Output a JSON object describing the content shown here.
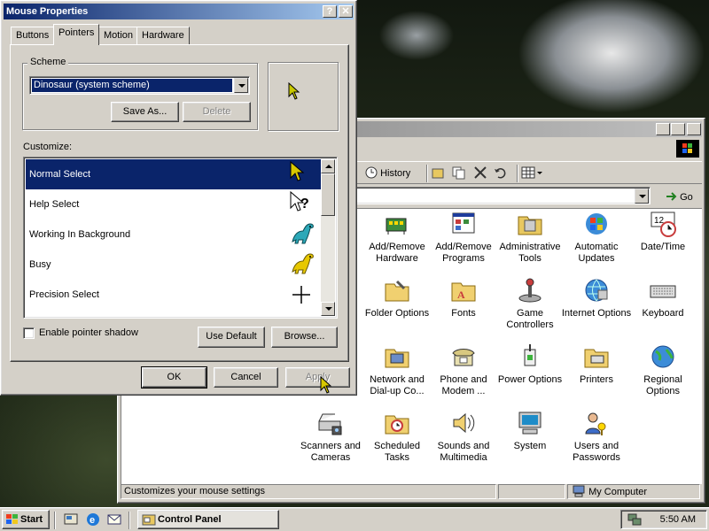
{
  "mouse_properties": {
    "title": "Mouse Properties",
    "tabs": [
      "Buttons",
      "Pointers",
      "Motion",
      "Hardware"
    ],
    "active_tab": "Pointers",
    "scheme_label": "Scheme",
    "scheme_value": "Dinosaur (system scheme)",
    "save_as_label": "Save As...",
    "delete_label": "Delete",
    "customize_label": "Customize:",
    "pointers": [
      {
        "label": "Normal Select",
        "icon": "arrow-cursor-icon"
      },
      {
        "label": "Help Select",
        "icon": "help-cursor-icon"
      },
      {
        "label": "Working In Background",
        "icon": "dinosaur-working-icon"
      },
      {
        "label": "Busy",
        "icon": "dinosaur-busy-icon"
      },
      {
        "label": "Precision Select",
        "icon": "crosshair-cursor-icon"
      }
    ],
    "selected_pointer": "Normal Select",
    "enable_shadow_label": "Enable pointer shadow",
    "use_default_label": "Use Default",
    "browse_label": "Browse...",
    "ok_label": "OK",
    "cancel_label": "Cancel",
    "apply_label": "Apply"
  },
  "control_panel": {
    "history_label": "History",
    "go_label": "Go",
    "items": [
      {
        "label": "Add/Remove Hardware",
        "icon": "hardware-icon"
      },
      {
        "label": "Add/Remove Programs",
        "icon": "programs-icon"
      },
      {
        "label": "Administrative Tools",
        "icon": "admin-tools-icon"
      },
      {
        "label": "Automatic Updates",
        "icon": "updates-icon"
      },
      {
        "label": "Date/Time",
        "icon": "datetime-icon"
      },
      {
        "label": "Folder Options",
        "icon": "folder-options-icon"
      },
      {
        "label": "Fonts",
        "icon": "fonts-icon"
      },
      {
        "label": "Game Controllers",
        "icon": "joystick-icon"
      },
      {
        "label": "Internet Options",
        "icon": "internet-icon"
      },
      {
        "label": "Keyboard",
        "icon": "keyboard-icon"
      },
      {
        "label": "Network and Dial-up Co...",
        "icon": "network-icon"
      },
      {
        "label": "Phone and Modem ...",
        "icon": "phone-icon"
      },
      {
        "label": "Power Options",
        "icon": "power-icon"
      },
      {
        "label": "Printers",
        "icon": "printers-icon"
      },
      {
        "label": "Regional Options",
        "icon": "globe-icon"
      },
      {
        "label": "Scanners and Cameras",
        "icon": "scanner-icon"
      },
      {
        "label": "Scheduled Tasks",
        "icon": "tasks-icon"
      },
      {
        "label": "Sounds and Multimedia",
        "icon": "sound-icon"
      },
      {
        "label": "System",
        "icon": "system-icon"
      },
      {
        "label": "Users and Passwords",
        "icon": "users-icon"
      }
    ],
    "status_text": "Customizes your mouse settings",
    "status_zone": "My Computer"
  },
  "taskbar": {
    "start_label": "Start",
    "task_label": "Control Panel",
    "clock": "5:50 AM"
  },
  "colors": {
    "selection": "#0a246a",
    "titlebar_active": "#0a246a",
    "face": "#d4d0c8"
  }
}
